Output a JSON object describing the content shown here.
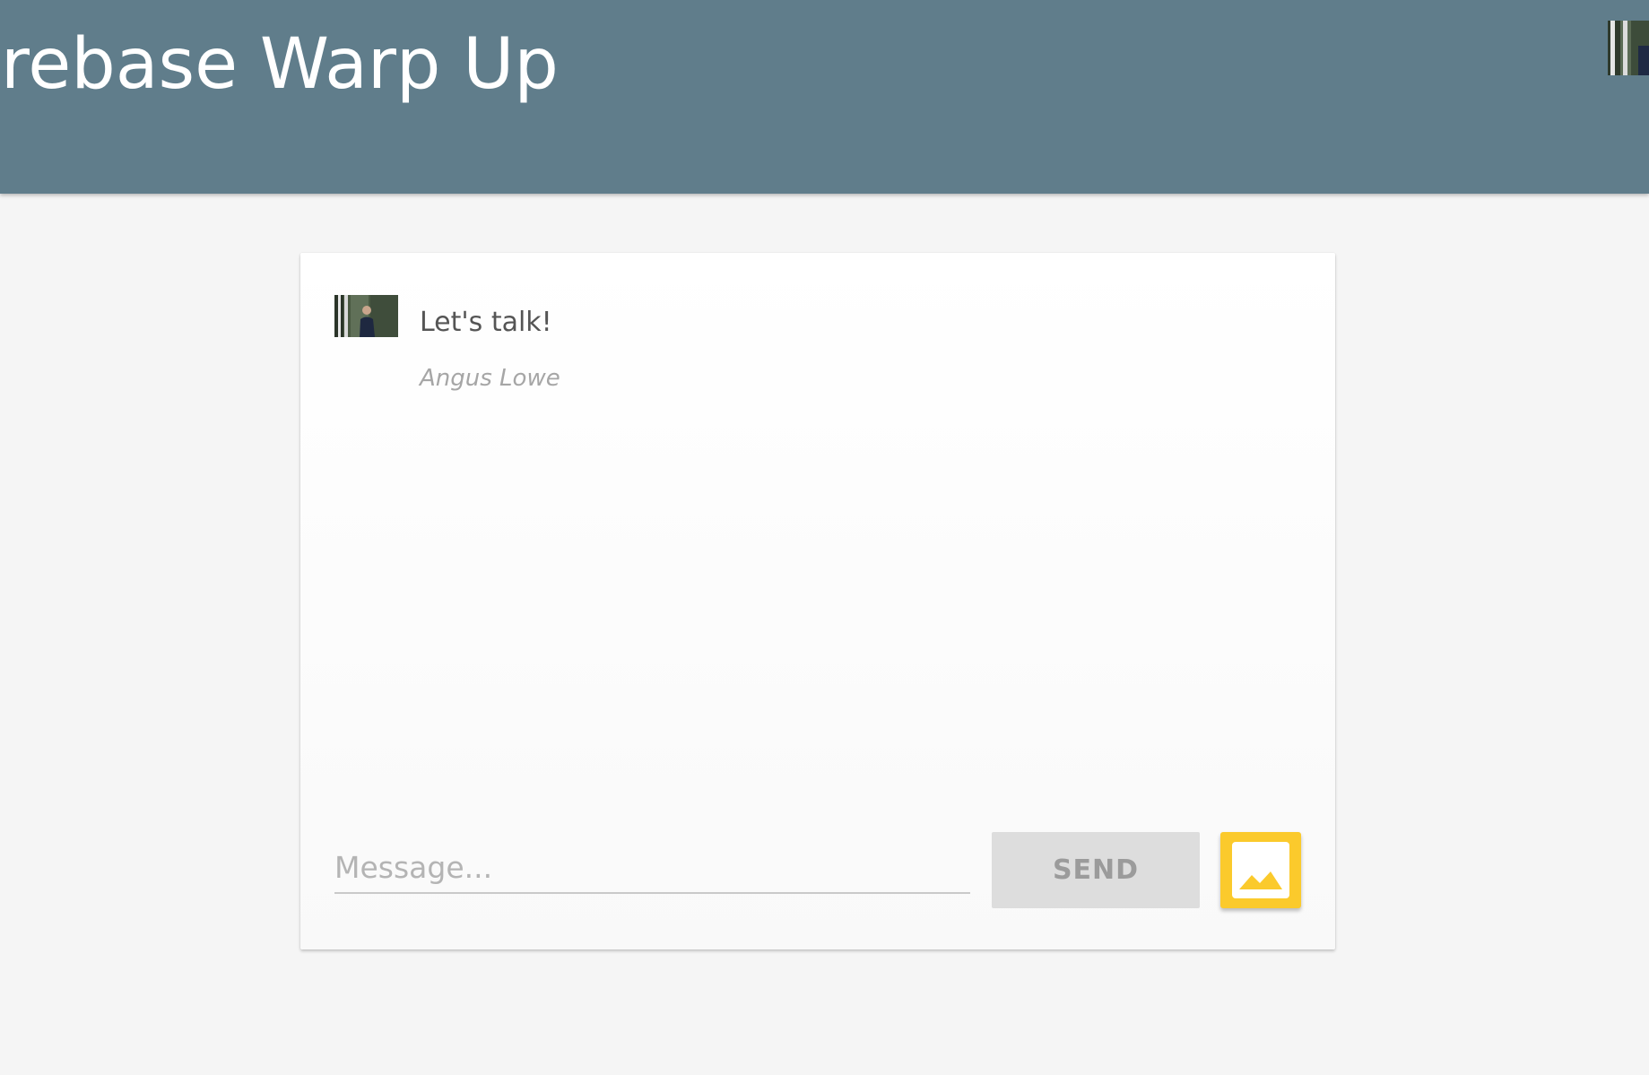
{
  "header": {
    "title": "Firebase Warp Up",
    "bg_color": "#607d8b",
    "avatar_icon": "user-avatar-photo"
  },
  "messages": [
    {
      "text": "Let's talk!",
      "author": "Angus Lowe",
      "avatar_icon": "user-avatar-photo"
    }
  ],
  "composer": {
    "placeholder": "Message...",
    "value": "",
    "send_label": "SEND",
    "image_button_icon": "image-icon",
    "image_button_color": "#fbca2c"
  }
}
